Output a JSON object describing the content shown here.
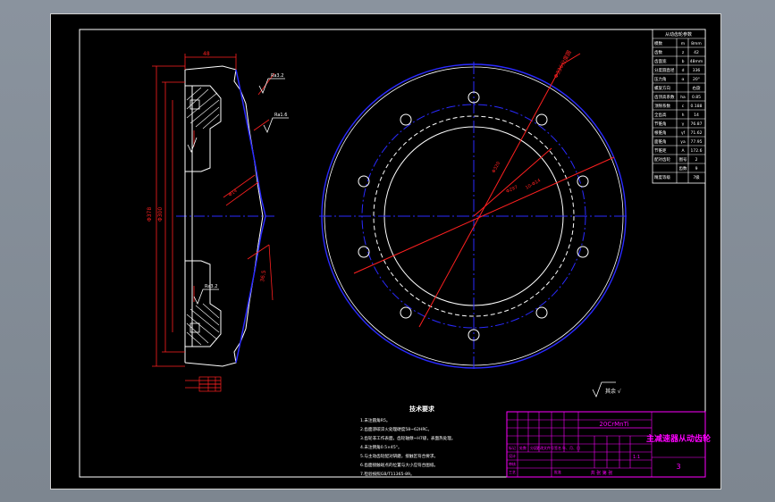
{
  "drawing": {
    "title_block": {
      "part_name": "主减速器从动齿轮",
      "sheet_number": "3",
      "material": "20CrMnTi",
      "scale": "1:1",
      "sheet_of": "共 张 第 张",
      "rows": [
        "标记",
        "处数",
        "分区",
        "更改文件号",
        "签名",
        "年、月、日",
        "设计",
        "审核",
        "工艺",
        "批准"
      ]
    },
    "parameter_table": {
      "header": "从动齿轮参数",
      "rows": [
        {
          "name": "模数",
          "symbol": "m",
          "value": "8mm"
        },
        {
          "name": "齿数",
          "symbol": "z",
          "value": "42"
        },
        {
          "name": "齿面宽",
          "symbol": "b",
          "value": "48mm"
        },
        {
          "name": "分度圆直径",
          "symbol": "d",
          "value": "336"
        },
        {
          "name": "压力角",
          "symbol": "α",
          "value": "20°"
        },
        {
          "name": "螺旋方向",
          "symbol": "",
          "value": "右旋"
        },
        {
          "name": "齿顶高系数",
          "symbol": "ha",
          "value": "0.85"
        },
        {
          "name": "顶隙系数",
          "symbol": "c",
          "value": "0.188"
        },
        {
          "name": "全齿高",
          "symbol": "h",
          "value": "14"
        },
        {
          "name": "节锥角",
          "symbol": "γ",
          "value": "76.87"
        },
        {
          "name": "根锥角",
          "symbol": "γf",
          "value": "71.62"
        },
        {
          "name": "面锥角",
          "symbol": "γa",
          "value": "77.95"
        },
        {
          "name": "节锥距",
          "symbol": "A",
          "value": "172.6"
        },
        {
          "name": "配对齿轮",
          "symbol": "图号",
          "value": "2"
        },
        {
          "name": "",
          "symbol": "齿数",
          "value": "9"
        },
        {
          "name": "精度等级",
          "symbol": "",
          "value": "7级"
        }
      ]
    },
    "tech_requirements": {
      "title": "技术要求",
      "items": [
        "1.未注圆角R5。",
        "2.齿面渗碳淬火处理硬度58~62HRC。",
        "3.齿轮非工作表面，齿轮轴颈~H7级，表面热处理。",
        "4.未注倒角0.5×45°。",
        "5.与主动齿轮配对研磨，接触区符合要求。",
        "6.齿面接触斑点的位置与大小应符合图纸。",
        "7.检验按照GB/T11365-89。"
      ]
    },
    "annotations": {
      "surface_finish_note": "其余 √",
      "roughness_top": "Ra3.2",
      "roughness_mid": "Ra1.6",
      "roughness_bottom": "Ra3.2",
      "dim_left_total": "Φ378",
      "dim_left_inner": "Φ300",
      "dim_bolt": "Φ14",
      "dim_width": "48",
      "dim_slant": "36.5",
      "circle_label_1": "Φ336分度圆",
      "circle_label_2": "Φ320",
      "circle_label_3": "Φ297",
      "hole_label": "10-Φ14"
    }
  },
  "colors": {
    "sheet": "#000000",
    "frame": "#ffffff",
    "red": "#ff2020",
    "blue": "#2a2aff",
    "magenta": "#ff00ff",
    "white": "#ffffff"
  }
}
